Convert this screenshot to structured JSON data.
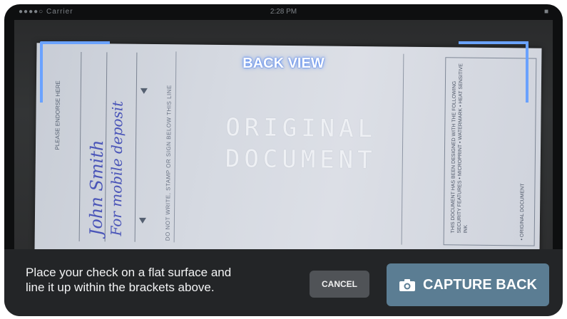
{
  "status_bar": {
    "left": "●●●●○ Carrier",
    "time": "2:28 PM",
    "right": "■"
  },
  "camera": {
    "overlay_title": "BACK VIEW",
    "check": {
      "endorse_label": "PLEASE ENDORSE HERE",
      "handwriting_line1": "John Smith",
      "handwriting_line2": "For mobile deposit",
      "do_not_write": "DO NOT WRITE, STAMP OR SIGN BELOW THIS LINE",
      "watermark_line1": "ORIGINAL",
      "watermark_line2": "DOCUMENT",
      "security_text": "THIS DOCUMENT HAS BEEN DESIGNED WITH THE FOLLOWING SECURITY FEATURES • MICROPRINT • WATERMARK • HEAT SENSITIVE INK",
      "edge_text": "• ORIGINAL DOCUMENT"
    }
  },
  "bottom": {
    "instructions": "Place your check on a flat surface and line it up within the brackets above.",
    "cancel_label": "CANCEL",
    "capture_label": "CAPTURE BACK"
  },
  "colors": {
    "bracket": "#6aa2ff",
    "capture_button": "#5b7d93",
    "cancel_button": "#505357"
  },
  "icons": {
    "capture": "camera-icon"
  }
}
